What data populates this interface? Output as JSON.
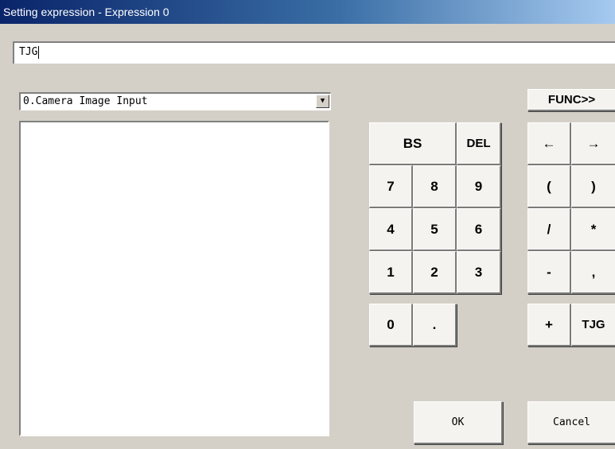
{
  "window": {
    "title": "Setting expression - Expression 0"
  },
  "expression": {
    "value": "TJG"
  },
  "source_select": {
    "value": "0.Camera Image Input",
    "arrow": "▼"
  },
  "func_button": {
    "label": "FUNC>>"
  },
  "keypad": {
    "bs": "BS",
    "del": "DEL",
    "k7": "7",
    "k8": "8",
    "k9": "9",
    "k4": "4",
    "k5": "5",
    "k6": "6",
    "k1": "1",
    "k2": "2",
    "k3": "3",
    "k0": "0",
    "dot": "."
  },
  "operators": {
    "left_arrow": "←",
    "right_arrow": "→",
    "open_paren": "(",
    "close_paren": ")",
    "divide": "/",
    "multiply": "*",
    "minus": "-",
    "comma": ",",
    "plus": "+",
    "tjg": "TJG"
  },
  "actions": {
    "ok": "OK",
    "cancel": "Cancel"
  }
}
